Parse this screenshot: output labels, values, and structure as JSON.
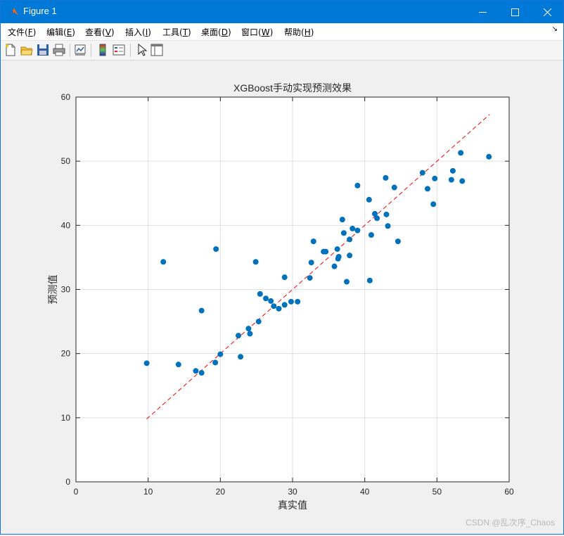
{
  "window": {
    "title": "Figure 1",
    "icon": "matlab-icon"
  },
  "menu": [
    {
      "label": "文件(",
      "key": "F",
      "tail": ")"
    },
    {
      "label": "编辑(",
      "key": "E",
      "tail": ")"
    },
    {
      "label": "查看(",
      "key": "V",
      "tail": ")"
    },
    {
      "label": "插入(",
      "key": "I",
      "tail": ")"
    },
    {
      "label": "工具(",
      "key": "T",
      "tail": ")"
    },
    {
      "label": "桌面(",
      "key": "D",
      "tail": ")"
    },
    {
      "label": "窗口(",
      "key": "W",
      "tail": ")"
    },
    {
      "label": "帮助(",
      "key": "H",
      "tail": ")"
    }
  ],
  "toolbar_icons": [
    "new-figure-icon",
    "open-file-icon",
    "save-icon",
    "print-icon",
    "link-plot-icon",
    "colorbar-icon",
    "legend-icon",
    "pointer-icon",
    "property-editor-icon"
  ],
  "watermark": "CSDN @乱次序_Chaos",
  "colors": {
    "accent": "#0078d7",
    "points": "#0072BD",
    "fit_line": "#ff0000"
  },
  "chart_data": {
    "type": "scatter",
    "title": "XGBoost手动实现预测效果",
    "xlabel": "真实值",
    "ylabel": "预测值",
    "xlim": [
      0,
      60
    ],
    "ylim": [
      0,
      60
    ],
    "xticks": [
      0,
      10,
      20,
      30,
      40,
      50,
      60
    ],
    "yticks": [
      0,
      10,
      20,
      30,
      40,
      50,
      60
    ],
    "grid": true,
    "reference_line": {
      "style": "dashed",
      "x": [
        9.8,
        57.3
      ],
      "y": [
        9.8,
        57.3
      ]
    },
    "series": [
      {
        "points": [
          [
            9.8,
            18.5
          ],
          [
            12.1,
            34.3
          ],
          [
            14.2,
            18.3
          ],
          [
            16.6,
            17.3
          ],
          [
            17.4,
            17.0
          ],
          [
            17.4,
            26.7
          ],
          [
            19.3,
            18.6
          ],
          [
            19.4,
            36.3
          ],
          [
            20.0,
            19.9
          ],
          [
            22.5,
            22.8
          ],
          [
            22.8,
            19.5
          ],
          [
            23.9,
            23.9
          ],
          [
            24.1,
            23.1
          ],
          [
            24.9,
            34.3
          ],
          [
            25.3,
            25.0
          ],
          [
            25.5,
            29.3
          ],
          [
            26.3,
            28.6
          ],
          [
            27.0,
            28.2
          ],
          [
            27.4,
            27.4
          ],
          [
            28.1,
            27.0
          ],
          [
            28.9,
            27.6
          ],
          [
            28.9,
            31.9
          ],
          [
            29.8,
            28.1
          ],
          [
            30.7,
            28.1
          ],
          [
            32.4,
            31.8
          ],
          [
            32.6,
            34.2
          ],
          [
            32.9,
            37.5
          ],
          [
            34.3,
            35.9
          ],
          [
            34.6,
            35.9
          ],
          [
            35.8,
            33.6
          ],
          [
            36.2,
            36.3
          ],
          [
            36.3,
            34.8
          ],
          [
            36.4,
            35.1
          ],
          [
            36.9,
            40.9
          ],
          [
            37.1,
            38.8
          ],
          [
            37.5,
            31.2
          ],
          [
            37.9,
            35.3
          ],
          [
            37.9,
            37.8
          ],
          [
            38.3,
            39.5
          ],
          [
            39.0,
            46.2
          ],
          [
            39.0,
            39.2
          ],
          [
            40.6,
            44.0
          ],
          [
            40.7,
            31.4
          ],
          [
            40.9,
            38.5
          ],
          [
            41.4,
            41.8
          ],
          [
            41.7,
            41.1
          ],
          [
            42.9,
            47.4
          ],
          [
            43.0,
            41.7
          ],
          [
            43.2,
            39.9
          ],
          [
            44.1,
            45.9
          ],
          [
            44.6,
            37.5
          ],
          [
            48.0,
            48.2
          ],
          [
            48.7,
            45.7
          ],
          [
            49.5,
            43.3
          ],
          [
            49.7,
            47.3
          ],
          [
            52.0,
            47.1
          ],
          [
            52.2,
            48.5
          ],
          [
            53.3,
            51.3
          ],
          [
            53.5,
            46.9
          ],
          [
            57.2,
            50.7
          ]
        ]
      }
    ]
  }
}
